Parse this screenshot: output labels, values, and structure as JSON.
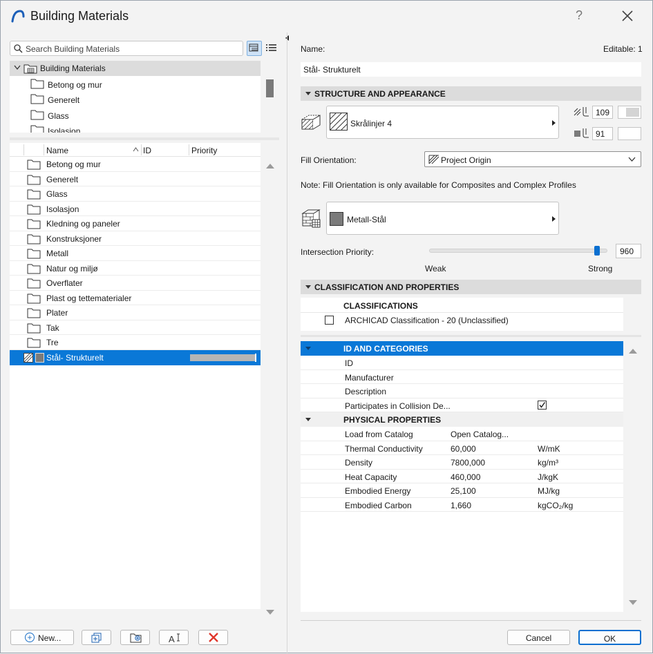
{
  "window": {
    "title": "Building Materials",
    "help_label": "?"
  },
  "search": {
    "placeholder": "Search Building Materials"
  },
  "tree": {
    "root": "Building Materials",
    "items": [
      "Betong og mur",
      "Generelt",
      "Glass",
      "Isolasjon"
    ]
  },
  "list": {
    "columns": {
      "name": "Name",
      "id": "ID",
      "priority": "Priority"
    },
    "rows": [
      "Betong og mur",
      "Generelt",
      "Glass",
      "Isolasjon",
      "Kledning og paneler",
      "Konstruksjoner",
      "Metall",
      "Natur og miljø",
      "Overflater",
      "Plast og tettematerialer",
      "Plater",
      "Tak",
      "Tre"
    ],
    "selected": "Stål- Strukturelt"
  },
  "buttons": {
    "new_label": "New...",
    "cancel_label": "Cancel",
    "ok_label": "OK"
  },
  "details": {
    "name_label": "Name:",
    "editable_label": "Editable: 1",
    "name_value": "Stål- Strukturelt",
    "structure_header": "STRUCTURE AND APPEARANCE",
    "cut_fill": "Skrålinjer 4",
    "fg_pen": "109",
    "bg_pen": "91",
    "fill_orientation_label": "Fill Orientation:",
    "fill_orientation_value": "Project Origin",
    "note": "Note: Fill Orientation is only available for Composites and Complex Profiles",
    "surface": "Metall-Stål",
    "intersection_label": "Intersection Priority:",
    "intersection_value": "960",
    "intersection_level": 0.94,
    "weak_label": "Weak",
    "strong_label": "Strong",
    "classification_header": "CLASSIFICATION AND PROPERTIES",
    "classifications_col": "CLASSIFICATIONS",
    "classification_item": "ARCHICAD Classification - 20 (Unclassified)"
  },
  "properties": {
    "id_header": "ID AND CATEGORIES",
    "id_rows": [
      {
        "name": "ID",
        "value": "",
        "unit": ""
      },
      {
        "name": "Manufacturer",
        "value": "",
        "unit": ""
      },
      {
        "name": "Description",
        "value": "",
        "unit": ""
      },
      {
        "name": "Participates in Collision De...",
        "value": "",
        "unit": ""
      }
    ],
    "physical_header": "PHYSICAL PROPERTIES",
    "physical_rows": [
      {
        "name": "Load from Catalog",
        "value": "Open Catalog...",
        "unit": ""
      },
      {
        "name": "Thermal Conductivity",
        "value": "60,000",
        "unit": "W/mK"
      },
      {
        "name": "Density",
        "value": "7800,000",
        "unit": "kg/m³"
      },
      {
        "name": "Heat Capacity",
        "value": "460,000",
        "unit": "J/kgK"
      },
      {
        "name": "Embodied Energy",
        "value": "25,100",
        "unit": "MJ/kg"
      },
      {
        "name": "Embodied Carbon",
        "value": "1,660",
        "unit": "kgCO₂/kg"
      }
    ]
  },
  "colors": {
    "accent": "#0a78d7",
    "delete": "#e0362b"
  }
}
